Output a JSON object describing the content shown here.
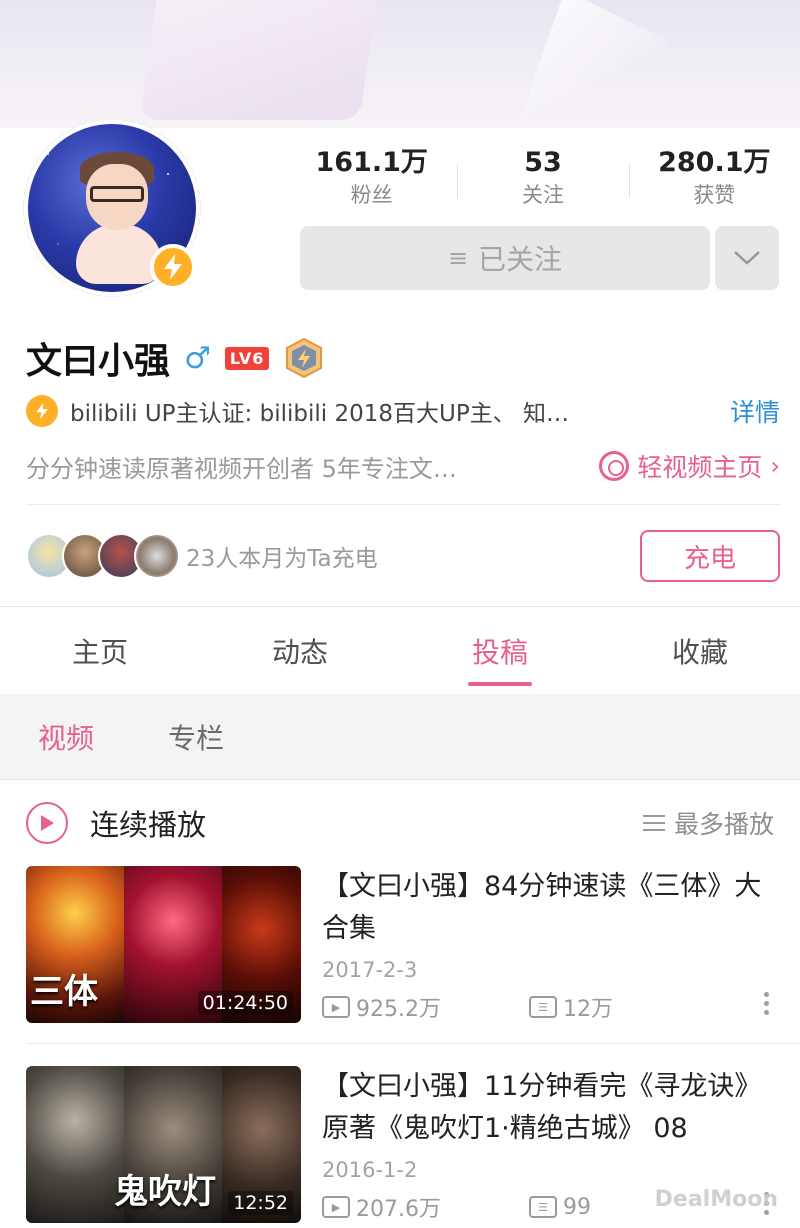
{
  "profile": {
    "name": "文曰小强",
    "gender_symbol": "♂",
    "level": "LV6",
    "stats": [
      {
        "value": "161.1万",
        "label": "粉丝"
      },
      {
        "value": "53",
        "label": "关注"
      },
      {
        "value": "280.1万",
        "label": "获赞"
      }
    ],
    "follow_label": "已关注",
    "follow_icon": "≡",
    "certification": "bilibili  UP主认证: bilibili  2018百大UP主、  知…",
    "details_label": "详情",
    "signature": "分分钟速读原著视频开创者  5年专注文…",
    "light_video_label": "轻视频主页",
    "charge_text": "23人本月为Ta充电",
    "charge_button": "充电"
  },
  "tabs": [
    {
      "label": "主页",
      "active": false
    },
    {
      "label": "动态",
      "active": false
    },
    {
      "label": "投稿",
      "active": true
    },
    {
      "label": "收藏",
      "active": false
    }
  ],
  "subtabs": [
    {
      "label": "视频",
      "active": true
    },
    {
      "label": "专栏",
      "active": false
    }
  ],
  "list": {
    "title": "连续播放",
    "sort_label": "最多播放"
  },
  "videos": [
    {
      "title": "【文曰小强】84分钟速读《三体》大合集",
      "thumb_text": "三体",
      "duration": "01:24:50",
      "date": "2017-2-3",
      "plays": "925.2万",
      "danmaku": "12万"
    },
    {
      "title": "【文曰小强】11分钟看完《寻龙诀》原著《鬼吹灯1·精绝古城》  08",
      "thumb_text": "鬼吹灯",
      "duration": "12:52",
      "date": "2016-1-2",
      "plays": "207.6万",
      "danmaku": "99"
    }
  ],
  "watermark": "DealMoon",
  "colors": {
    "accent": "#e8618a",
    "link_blue": "#2d8fd6",
    "verify_yellow": "#ffb027",
    "level_red": "#f0413b"
  }
}
